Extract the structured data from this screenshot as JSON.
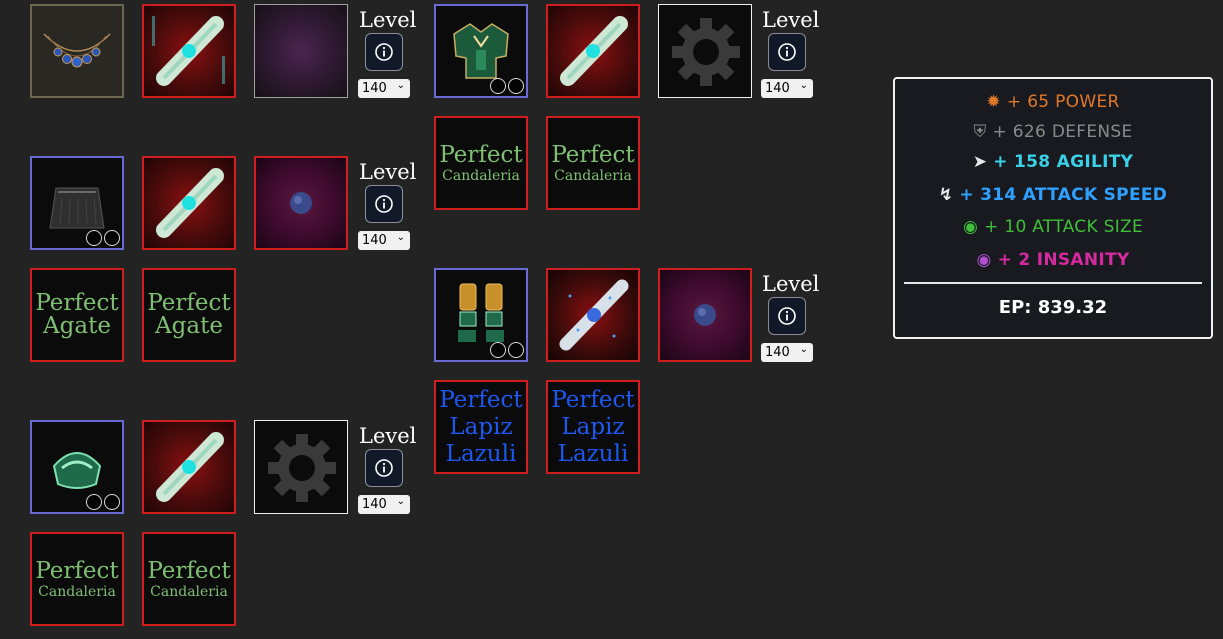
{
  "level_label": "Level",
  "level_options": {
    "head": "140",
    "back": "140",
    "helm": "140",
    "chest": "140",
    "legs": "140"
  },
  "gems": {
    "agate_1": {
      "name": "Perfect",
      "sub": "Agate"
    },
    "agate_2": {
      "name": "Perfect",
      "sub": "Agate"
    },
    "cand_1": {
      "name": "Perfect",
      "sub": "Candaleria"
    },
    "cand_2": {
      "name": "Perfect",
      "sub": "Candaleria"
    },
    "cand_3": {
      "name": "Perfect",
      "sub": "Candaleria"
    },
    "cand_4": {
      "name": "Perfect",
      "sub": "Candaleria"
    },
    "lapiz_1": {
      "l1": "Perfect",
      "l2": "Lapiz",
      "l3": "Lazuli"
    },
    "lapiz_2": {
      "l1": "Perfect",
      "l2": "Lapiz",
      "l3": "Lazuli"
    }
  },
  "stats": [
    {
      "icon": "star-burst-icon",
      "sign": "+",
      "text": "65 POWER",
      "color": "#e0782a",
      "bold": false
    },
    {
      "icon": "shield-icon",
      "sign": "+",
      "text": "626 DEFENSE",
      "color": "#8a8a8a",
      "bold": false
    },
    {
      "icon": "running-icon",
      "sign": "+",
      "text": "158 AGILITY",
      "color": "#3ad0e8",
      "bold": true
    },
    {
      "icon": "lightning-icon",
      "sign": "+",
      "text": "314 ATTACK SPEED",
      "color": "#2ea0ff",
      "bold": true
    },
    {
      "icon": "planet-icon",
      "sign": "+",
      "text": "10 ATTACK SIZE",
      "color": "#3fbf3a",
      "bold": false
    },
    {
      "icon": "eye-icon",
      "sign": "+",
      "text": "2 INSANITY",
      "color": "#d42aa0",
      "bold": true
    }
  ],
  "ep": "EP: 839.32"
}
